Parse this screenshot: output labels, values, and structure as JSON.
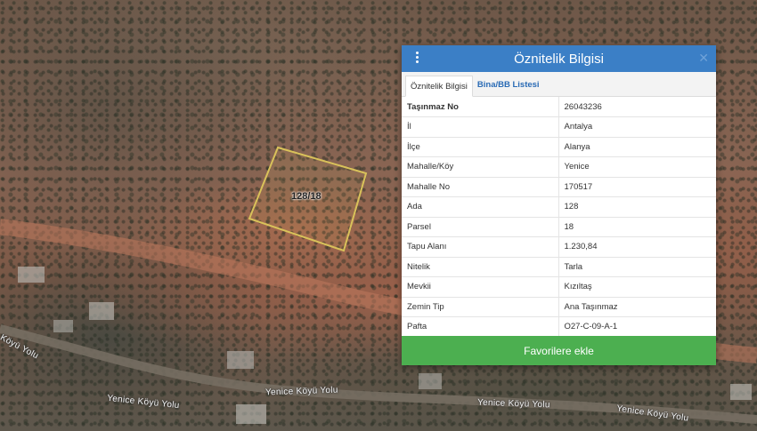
{
  "map": {
    "parcel_label": "128/18",
    "road_labels": [
      "Köyü Yolu",
      "Yenice Köyü Yolu",
      "Yenice Köyü Yolu",
      "Yenice Köyü Yolu",
      "Yenice Köyü Yolu"
    ]
  },
  "panel": {
    "title": "Öznitelik Bilgisi",
    "menu_icon": "vertical-dots-icon",
    "close_icon": "close-icon",
    "tabs": [
      {
        "label": "Öznitelik Bilgisi",
        "active": true
      },
      {
        "label": "Bina/BB Listesi",
        "active": false
      }
    ],
    "rows": [
      {
        "key": "Taşınmaz No",
        "value": "26043236"
      },
      {
        "key": "İl",
        "value": "Antalya"
      },
      {
        "key": "İlçe",
        "value": "Alanya"
      },
      {
        "key": "Mahalle/Köy",
        "value": "Yenice"
      },
      {
        "key": "Mahalle No",
        "value": "170517"
      },
      {
        "key": "Ada",
        "value": "128"
      },
      {
        "key": "Parsel",
        "value": "18"
      },
      {
        "key": "Tapu Alanı",
        "value": "1.230,84"
      },
      {
        "key": "Nitelik",
        "value": "Tarla"
      },
      {
        "key": "Mevkii",
        "value": "Kızıltaş"
      },
      {
        "key": "Zemin Tip",
        "value": "Ana Taşınmaz"
      },
      {
        "key": "Pafta",
        "value": "O27-C-09-A-1"
      }
    ],
    "favorite_button": "Favorilere ekle"
  },
  "colors": {
    "header": "#3b7fc6",
    "button": "#4caf50",
    "parcel_outline": "#d9c25a"
  }
}
